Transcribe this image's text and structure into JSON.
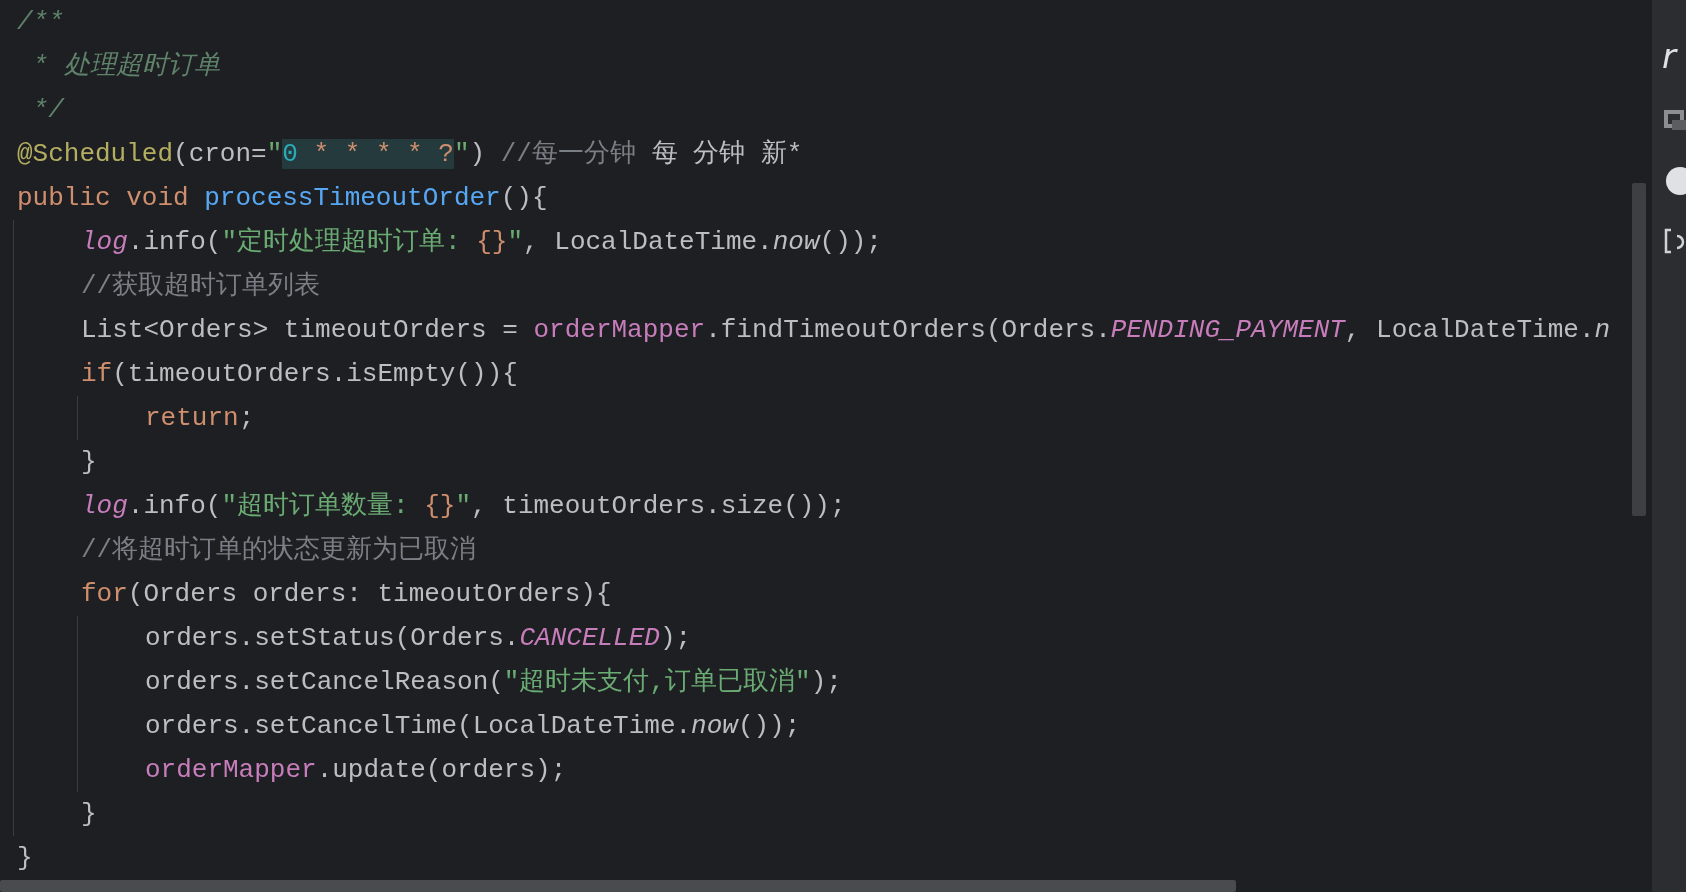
{
  "editor": {
    "lines": [
      {
        "tokens": [
          {
            "kind": "doc",
            "text": "/**"
          }
        ]
      },
      {
        "tokens": [
          {
            "kind": "doc",
            "text": " * 处理超时订单"
          }
        ]
      },
      {
        "tokens": [
          {
            "kind": "doc",
            "text": " */"
          }
        ]
      },
      {
        "tokens": [
          {
            "kind": "annotation",
            "text": "@Scheduled"
          },
          {
            "kind": "plain",
            "text": "(cron="
          },
          {
            "kind": "string",
            "text": "\""
          },
          {
            "kind": "cron-minute",
            "text": "0"
          },
          {
            "kind": "cron-wildcard",
            "text": " * * * * ?"
          },
          {
            "kind": "string",
            "text": "\""
          },
          {
            "kind": "plain",
            "text": ") "
          },
          {
            "kind": "comment",
            "text": "//每一分钟 "
          },
          {
            "kind": "ime",
            "text": "每 分钟 新*"
          }
        ]
      },
      {
        "tokens": [
          {
            "kind": "keyword",
            "text": "public void "
          },
          {
            "kind": "method-decl",
            "text": "processTimeoutOrder"
          },
          {
            "kind": "plain",
            "text": "(){"
          }
        ],
        "children": [
          {
            "tokens": [
              {
                "kind": "static-field",
                "text": "log"
              },
              {
                "kind": "plain",
                "text": ".info("
              },
              {
                "kind": "string",
                "text": "\"定时处理超时订单: "
              },
              {
                "kind": "placeholder",
                "text": "{}"
              },
              {
                "kind": "string",
                "text": "\""
              },
              {
                "kind": "plain",
                "text": ", LocalDateTime."
              },
              {
                "kind": "static-call",
                "text": "now"
              },
              {
                "kind": "plain",
                "text": "());"
              }
            ]
          },
          {
            "tokens": [
              {
                "kind": "comment",
                "text": "//获取超时订单列表"
              }
            ]
          },
          {
            "tokens": [
              {
                "kind": "plain",
                "text": "List<Orders> timeoutOrders = "
              },
              {
                "kind": "field",
                "text": "orderMapper"
              },
              {
                "kind": "plain",
                "text": ".findTimeoutOrders(Orders."
              },
              {
                "kind": "static-field",
                "text": "PENDING_PAYMENT"
              },
              {
                "kind": "plain",
                "text": ", LocalDateTime."
              },
              {
                "kind": "static-call",
                "text": "n"
              }
            ]
          },
          {
            "tokens": [
              {
                "kind": "keyword",
                "text": "if"
              },
              {
                "kind": "plain",
                "text": "(timeoutOrders.isEmpty()){"
              }
            ],
            "children": [
              {
                "tokens": [
                  {
                    "kind": "keyword",
                    "text": "return"
                  },
                  {
                    "kind": "plain",
                    "text": ";"
                  }
                ]
              }
            ]
          },
          {
            "tokens": [
              {
                "kind": "plain",
                "text": "}"
              }
            ]
          },
          {
            "tokens": [
              {
                "kind": "static-field",
                "text": "log"
              },
              {
                "kind": "plain",
                "text": ".info("
              },
              {
                "kind": "string",
                "text": "\"超时订单数量: "
              },
              {
                "kind": "placeholder",
                "text": "{}"
              },
              {
                "kind": "string",
                "text": "\""
              },
              {
                "kind": "plain",
                "text": ", timeoutOrders.size());"
              }
            ]
          },
          {
            "tokens": [
              {
                "kind": "comment",
                "text": "//将超时订单的状态更新为已取消"
              }
            ]
          },
          {
            "tokens": [
              {
                "kind": "keyword",
                "text": "for"
              },
              {
                "kind": "plain",
                "text": "(Orders orders: timeoutOrders){"
              }
            ],
            "children": [
              {
                "tokens": [
                  {
                    "kind": "plain",
                    "text": "orders.setStatus(Orders."
                  },
                  {
                    "kind": "static-field",
                    "text": "CANCELLED"
                  },
                  {
                    "kind": "plain",
                    "text": ");"
                  }
                ]
              },
              {
                "tokens": [
                  {
                    "kind": "plain",
                    "text": "orders.setCancelReason("
                  },
                  {
                    "kind": "string",
                    "text": "\"超时未支付,订单已取消\""
                  },
                  {
                    "kind": "plain",
                    "text": ");"
                  }
                ]
              },
              {
                "tokens": [
                  {
                    "kind": "plain",
                    "text": "orders.setCancelTime(LocalDateTime."
                  },
                  {
                    "kind": "static-call",
                    "text": "now"
                  },
                  {
                    "kind": "plain",
                    "text": "());"
                  }
                ]
              },
              {
                "tokens": [
                  {
                    "kind": "field",
                    "text": "orderMapper"
                  },
                  {
                    "kind": "plain",
                    "text": ".update(orders);"
                  }
                ]
              }
            ]
          },
          {
            "tokens": [
              {
                "kind": "plain",
                "text": "}"
              }
            ]
          }
        ]
      },
      {
        "tokens": [
          {
            "kind": "plain",
            "text": "}"
          }
        ]
      }
    ]
  },
  "side_panel": {
    "label": "r"
  }
}
